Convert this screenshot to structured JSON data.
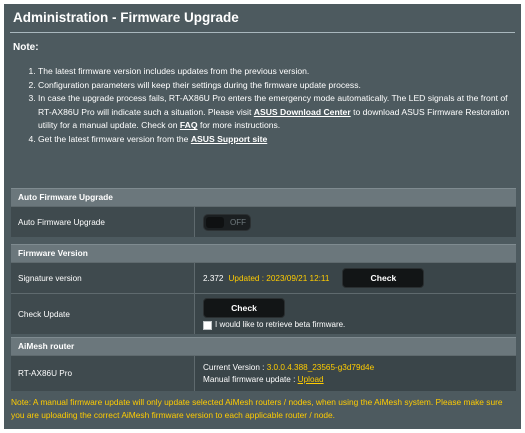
{
  "page": {
    "title": "Administration - Firmware Upgrade",
    "note_heading": "Note:"
  },
  "notes": {
    "item1": "The latest firmware version includes updates from the previous version.",
    "item2": "Configuration parameters will keep their settings during the firmware update process.",
    "item3_a": "In case the upgrade process fails, RT-AX86U Pro enters the emergency mode automatically. The LED signals at the front of RT-AX86U Pro will indicate such a situation. Please visit ",
    "item3_link1": "ASUS Download Center",
    "item3_b": " to download ASUS Firmware Restoration utility for a manual update. Check on ",
    "item3_link2": "FAQ",
    "item3_c": " for more instructions.",
    "item4_a": "Get the latest firmware version from the ",
    "item4_link": "ASUS Support site"
  },
  "auto_upgrade": {
    "section_title": "Auto Firmware Upgrade",
    "label": "Auto Firmware Upgrade",
    "toggle_state": "OFF"
  },
  "firmware_version": {
    "section_title": "Firmware Version",
    "signature_label": "Signature version",
    "signature_value": "2.372",
    "signature_updated": "Updated : 2023/09/21 12:11",
    "check_button": "Check",
    "check_update_label": "Check Update",
    "check_update_button": "Check",
    "beta_checkbox_label": "I would like to retrieve beta firmware.",
    "beta_checked": false
  },
  "aimesh": {
    "section_title": "AiMesh router",
    "router_label": "RT-AX86U Pro",
    "current_version_label": "Current Version : ",
    "current_version_value": "3.0.0.4.388_23565-g3d79d4e",
    "manual_update_label": "Manual firmware update : ",
    "upload_link": "Upload"
  },
  "footer_note": "Note: A manual firmware update will only update selected AiMesh routers / nodes, when using the AiMesh system. Please make sure you are uploading the correct AiMesh firmware version to each applicable router / node.",
  "colors": {
    "panel_bg": "#4d5a5f",
    "section_header_bg": "#6b777c",
    "row_bg": "#3f4a4e",
    "accent_yellow": "#ffcc00",
    "button_bg": "#121516"
  }
}
